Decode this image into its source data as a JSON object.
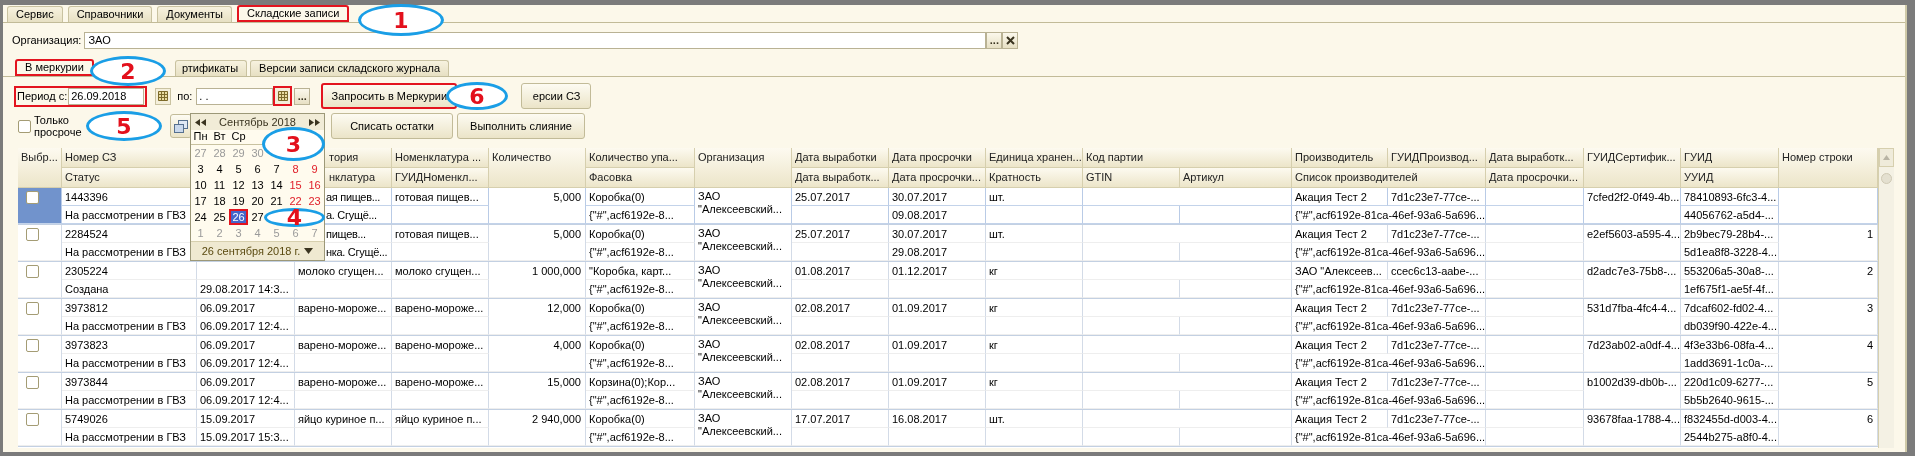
{
  "top_tabs": [
    {
      "label": "Сервис",
      "selected": false,
      "highlighted": false
    },
    {
      "label": "Справочники",
      "selected": false,
      "highlighted": false
    },
    {
      "label": "Документы",
      "selected": false,
      "highlighted": false
    },
    {
      "label": "Складские записи",
      "selected": true,
      "highlighted": true
    }
  ],
  "organization": {
    "label": "Организация:",
    "value": "ЗАО",
    "choose_button": "..."
  },
  "inner_tabs": [
    {
      "label": "В меркурии",
      "selected": true,
      "highlighted": true
    },
    {
      "label": "ртификаты",
      "selected": false,
      "highlighted": false
    },
    {
      "label": "Версии записи складского журнала",
      "selected": false,
      "highlighted": false
    }
  ],
  "period": {
    "label": "Период с:",
    "value": "26.09.2018",
    "highlighted": true
  },
  "period_to": {
    "label": "по:",
    "value": ". .",
    "calendar_highlighted": true,
    "choose_button": "..."
  },
  "buttons": [
    {
      "label": "Запросить в Меркурии",
      "highlighted": true
    },
    {
      "label": "ерсии СЗ",
      "highlighted": false
    },
    {
      "label": "Списать остатки",
      "highlighted": false
    },
    {
      "label": "Выполнить слияние",
      "highlighted": false
    }
  ],
  "expired_only": {
    "label": "Только просроче",
    "checked": false
  },
  "callouts": [
    "1",
    "2",
    "3",
    "4",
    "5",
    "6"
  ],
  "calendar": {
    "month": "Сентябрь 2018",
    "weekdays": [
      "Пн",
      "Вт",
      "Ср"
    ],
    "footer": "26 сентября 2018 г.",
    "weeks": [
      [
        {
          "day": "27",
          "muted": true,
          "weekend": false,
          "selected": false,
          "highlighted": false
        },
        {
          "day": "28",
          "muted": true,
          "weekend": false,
          "selected": false,
          "highlighted": false
        },
        {
          "day": "29",
          "muted": true,
          "weekend": false,
          "selected": false,
          "highlighted": false
        },
        {
          "day": "30",
          "muted": true,
          "weekend": false,
          "selected": false,
          "highlighted": false
        }
      ],
      [
        {
          "day": "3",
          "muted": false,
          "weekend": false,
          "selected": false,
          "highlighted": false
        },
        {
          "day": "4",
          "muted": false,
          "weekend": false,
          "selected": false,
          "highlighted": false
        },
        {
          "day": "5",
          "muted": false,
          "weekend": false,
          "selected": false,
          "highlighted": false
        },
        {
          "day": "6",
          "muted": false,
          "weekend": false,
          "selected": false,
          "highlighted": false
        },
        {
          "day": "7",
          "muted": false,
          "weekend": false,
          "selected": false,
          "highlighted": false
        },
        {
          "day": "8",
          "muted": false,
          "weekend": true,
          "selected": false,
          "highlighted": false
        },
        {
          "day": "9",
          "muted": false,
          "weekend": true,
          "selected": false,
          "highlighted": false
        }
      ],
      [
        {
          "day": "10",
          "muted": false,
          "weekend": false,
          "selected": false,
          "highlighted": false
        },
        {
          "day": "11",
          "muted": false,
          "weekend": false,
          "selected": false,
          "highlighted": false
        },
        {
          "day": "12",
          "muted": false,
          "weekend": false,
          "selected": false,
          "highlighted": false
        },
        {
          "day": "13",
          "muted": false,
          "weekend": false,
          "selected": false,
          "highlighted": false
        },
        {
          "day": "14",
          "muted": false,
          "weekend": false,
          "selected": false,
          "highlighted": false
        },
        {
          "day": "15",
          "muted": false,
          "weekend": true,
          "selected": false,
          "highlighted": false
        },
        {
          "day": "16",
          "muted": false,
          "weekend": true,
          "selected": false,
          "highlighted": false
        }
      ],
      [
        {
          "day": "17",
          "muted": false,
          "weekend": false,
          "selected": false,
          "highlighted": false
        },
        {
          "day": "18",
          "muted": false,
          "weekend": false,
          "selected": false,
          "highlighted": false
        },
        {
          "day": "19",
          "muted": false,
          "weekend": false,
          "selected": false,
          "highlighted": false
        },
        {
          "day": "20",
          "muted": false,
          "weekend": false,
          "selected": false,
          "highlighted": false
        },
        {
          "day": "21",
          "muted": false,
          "weekend": false,
          "selected": false,
          "highlighted": false
        },
        {
          "day": "22",
          "muted": false,
          "weekend": true,
          "selected": false,
          "highlighted": false
        },
        {
          "day": "23",
          "muted": false,
          "weekend": true,
          "selected": false,
          "highlighted": false
        }
      ],
      [
        {
          "day": "24",
          "muted": false,
          "weekend": false,
          "selected": false,
          "highlighted": false
        },
        {
          "day": "25",
          "muted": false,
          "weekend": false,
          "selected": false,
          "highlighted": false
        },
        {
          "day": "26",
          "muted": false,
          "weekend": false,
          "selected": true,
          "highlighted": true
        },
        {
          "day": "27",
          "muted": false,
          "weekend": false,
          "selected": false,
          "highlighted": false
        }
      ],
      [
        {
          "day": "1",
          "muted": true,
          "weekend": false,
          "selected": false,
          "highlighted": false
        },
        {
          "day": "2",
          "muted": true,
          "weekend": false,
          "selected": false,
          "highlighted": false
        },
        {
          "day": "3",
          "muted": true,
          "weekend": false,
          "selected": false,
          "highlighted": false
        },
        {
          "day": "4",
          "muted": true,
          "weekend": false,
          "selected": false,
          "highlighted": false
        },
        {
          "day": "5",
          "muted": true,
          "weekend": false,
          "selected": false,
          "highlighted": false
        },
        {
          "day": "6",
          "muted": true,
          "weekend": false,
          "selected": false,
          "highlighted": false
        },
        {
          "day": "7",
          "muted": true,
          "weekend": false,
          "selected": false,
          "highlighted": false
        }
      ]
    ]
  },
  "table": {
    "columns_top": [
      "Выбр...",
      "Номер СЗ",
      "тория",
      "Номенклатура ...",
      "Количество",
      "Количество упа...",
      "Организация",
      "Дата выработки",
      "Дата просрочки",
      "Единица хранен...",
      "Код партии",
      "Производитель",
      "ГУИДПроизвод...",
      "Дата выработк...",
      "ГУИДСертифик...",
      "ГУИД",
      "Номер строки"
    ],
    "columns_bottom": [
      "Статус",
      "нклатура",
      "ГУИДНоменкл...",
      "Фасовка",
      "Дата выработк...",
      "Дата просрочки...",
      "Кратность",
      "GTIN",
      "Артикул",
      "Список производителей",
      "Дата просрочки...",
      "УУИД"
    ],
    "rows": [
      {
        "selected": true,
        "checked": false,
        "number": "1443396",
        "status": "На рассмотрении в ГВЗ",
        "column_3": "ая пищев...",
        "column_3_sub": "а. Сгущё...",
        "nomenclature": "готовая пищев...",
        "quantity": "5,000",
        "packages": "Коробка(0)",
        "packing": "{\"#\",acf6192e-8...",
        "organization": "ЗАО \"Алексеевский...",
        "production_date": "25.07.2017",
        "expiry_date": "30.07.2017",
        "expiry_date_2": "09.08.2017",
        "unit": "шт.",
        "producer": "Акация Тест 2",
        "producer_guid": "7d1c23e7-77ce-...",
        "producer_list": "{\"#\",acf6192e-81ca-46ef-93a6-5a696...",
        "certificate_guid": "7cfed2f2-0f49-4b...",
        "guid": "78410893-6fc3-4...",
        "uuid": "44056762-a5d4-..."
      },
      {
        "selected": false,
        "checked": false,
        "number": "2284524",
        "status": "На рассмотрении в ГВЗ",
        "column_3": "пищев...",
        "column_3_sub": "нка. Сгущё...",
        "nomenclature": "готовая пищев...",
        "quantity": "5,000",
        "packages": "Коробка(0)",
        "packing": "{\"#\",acf6192e-8...",
        "organization": "ЗАО \"Алексеевский...",
        "production_date": "25.07.2017",
        "expiry_date": "30.07.2017",
        "expiry_date_2": "29.08.2017",
        "unit": "шт.",
        "producer": "Акация Тест 2",
        "producer_guid": "7d1c23e7-77ce-...",
        "producer_list": "{\"#\",acf6192e-81ca-46ef-93a6-5a696...",
        "certificate_guid": "e2ef5603-a595-4...",
        "guid": "2b9bec79-28b4-...",
        "uuid": "5d1ea8f8-3228-4...",
        "row_number": "1"
      },
      {
        "selected": false,
        "checked": false,
        "number": "2305224",
        "status": "Создана",
        "column_2_sub": "29.08.2017 14:3...",
        "column_3": "молоко сгущен...",
        "nomenclature": "молоко сгущен...",
        "quantity": "1 000,000",
        "packages": "\"Коробка, карт...",
        "packing": "{\"#\",acf6192e-8...",
        "organization": "ЗАО \"Алексеевский...",
        "production_date": "01.08.2017",
        "expiry_date": "01.12.2017",
        "unit": "кг",
        "producer": "ЗАО \"Алексеев...",
        "producer_guid": "ccec6c13-aabe-...",
        "producer_list": "{\"#\",acf6192e-81ca-46ef-93a6-5a696...",
        "certificate_guid": "d2adc7e3-75b8-...",
        "guid": "553206a5-30a8-...",
        "uuid": "1ef675f1-ae5f-4f...",
        "row_number": "2"
      },
      {
        "selected": false,
        "checked": false,
        "number": "3973812",
        "status": "На рассмотрении в ГВЗ",
        "column_2": "06.09.2017",
        "column_2_sub": "06.09.2017 12:4...",
        "column_3": "варено-мороже...",
        "nomenclature": "варено-мороже...",
        "quantity": "12,000",
        "packages": "Коробка(0)",
        "packing": "{\"#\",acf6192e-8...",
        "organization": "ЗАО \"Алексеевский...",
        "production_date": "02.08.2017",
        "expiry_date": "01.09.2017",
        "unit": "кг",
        "producer": "Акация Тест 2",
        "producer_guid": "7d1c23e7-77ce-...",
        "producer_list": "{\"#\",acf6192e-81ca-46ef-93a6-5a696...",
        "certificate_guid": "531d7fba-4fc4-4...",
        "guid": "7dcaf602-fd02-4...",
        "uuid": "db039f90-422e-4...",
        "row_number": "3"
      },
      {
        "selected": false,
        "checked": false,
        "number": "3973823",
        "status": "На рассмотрении в ГВЗ",
        "column_2": "06.09.2017",
        "column_2_sub": "06.09.2017 12:4...",
        "column_3": "варено-мороже...",
        "nomenclature": "варено-мороже...",
        "quantity": "4,000",
        "packages": "Коробка(0)",
        "packing": "{\"#\",acf6192e-8...",
        "organization": "ЗАО \"Алексеевский...",
        "production_date": "02.08.2017",
        "expiry_date": "01.09.2017",
        "unit": "кг",
        "producer": "Акация Тест 2",
        "producer_guid": "7d1c23e7-77ce-...",
        "producer_list": "{\"#\",acf6192e-81ca-46ef-93a6-5a696...",
        "certificate_guid": "7d23ab02-a0df-4...",
        "guid": "4f3e33b6-08fa-4...",
        "uuid": "1add3691-1c0a-...",
        "row_number": "4"
      },
      {
        "selected": false,
        "checked": false,
        "number": "3973844",
        "status": "На рассмотрении в ГВЗ",
        "column_2": "06.09.2017",
        "column_2_sub": "06.09.2017 12:4...",
        "column_3": "варено-мороже...",
        "nomenclature": "варено-мороже...",
        "quantity": "15,000",
        "packages": "Корзина(0);Кор...",
        "packing": "{\"#\",acf6192e-8...",
        "organization": "ЗАО \"Алексеевский...",
        "production_date": "02.08.2017",
        "expiry_date": "01.09.2017",
        "unit": "кг",
        "producer": "Акация Тест 2",
        "producer_guid": "7d1c23e7-77ce-...",
        "producer_list": "{\"#\",acf6192e-81ca-46ef-93a6-5a696...",
        "certificate_guid": "b1002d39-db0b-...",
        "guid": "220d1c09-6277-...",
        "uuid": "5b5b2640-9615-...",
        "row_number": "5"
      },
      {
        "selected": false,
        "checked": false,
        "number": "5749026",
        "status": "На рассмотрении в ГВЗ",
        "column_2": "15.09.2017",
        "column_2_sub": "15.09.2017 15:3...",
        "column_3": "яйцо куриное п...",
        "nomenclature": "яйцо куриное п...",
        "quantity": "2 940,000",
        "packages": "Коробка(0)",
        "packing": "{\"#\",acf6192e-8...",
        "organization": "ЗАО \"Алексеевский...",
        "production_date": "17.07.2017",
        "expiry_date": "16.08.2017",
        "unit": "шт.",
        "producer": "Акация Тест 2",
        "producer_guid": "7d1c23e7-77ce-...",
        "producer_list": "{\"#\",acf6192e-81ca-46ef-93a6-5a696...",
        "certificate_guid": "93678faa-1788-4...",
        "guid": "f832455d-d003-4...",
        "uuid": "2544b275-a8f0-4...",
        "row_number": "6"
      }
    ]
  }
}
